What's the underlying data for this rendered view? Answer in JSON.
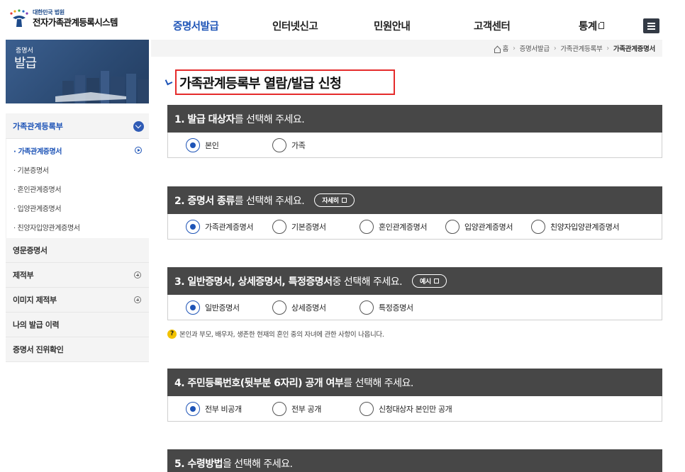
{
  "header": {
    "logo_sub": "대한민국 법원",
    "logo_main": "전자가족관계등록시스템",
    "nav": [
      "증명서발급",
      "인터넷신고",
      "민원안내",
      "고객센터",
      "통계"
    ]
  },
  "sidebar": {
    "banner_line1": "증명서",
    "banner_line2": "발급",
    "group_title": "가족관계등록부",
    "sub_items": [
      "· 가족관계증명서",
      "· 기본증명서",
      "· 혼인관계증명서",
      "· 입양관계증명서",
      "· 친양자입양관계증명서"
    ],
    "rows": [
      "영문증명서",
      "제적부",
      "이미지 제적부",
      "나의 발급 이력",
      "증명서 진위확인"
    ]
  },
  "breadcrumb": {
    "home": "홈",
    "items": [
      "증명서발급",
      "가족관계등록부",
      "가족관계증명서"
    ]
  },
  "page_title": "가족관계등록부 열람/발급 신청",
  "sections": [
    {
      "head_bold": "1. 발급 대상자",
      "head_rest": "를 선택해 주세요.",
      "options": [
        "본인",
        "가족"
      ],
      "selected": 0
    },
    {
      "head_bold": "2. 증명서 종류",
      "head_rest": "를 선택해 주세요.",
      "pill": "자세히",
      "options": [
        "가족관계증명서",
        "기본증명서",
        "혼인관계증명서",
        "입양관계증명서",
        "친양자입양관계증명서"
      ],
      "selected": 0
    },
    {
      "head_bold": "3. 일반증명서, 상세증명서, 특정증명서",
      "head_rest": " 중 선택해 주세요.",
      "pill": "예시",
      "options": [
        "일반증명서",
        "상세증명서",
        "특정증명서"
      ],
      "selected": 0
    },
    {
      "head_bold": "4. 주민등록번호(뒷부분 6자리) 공개 여부",
      "head_rest": "를 선택해 주세요.",
      "options": [
        "전부 비공개",
        "전부 공개",
        "신청대상자 본인만 공개"
      ],
      "selected": 0
    },
    {
      "head_bold": "5. 수령방법",
      "head_rest": "을 선택해 주세요."
    }
  ],
  "note": "본인과 부모, 배우자, 생존한 현재의 혼인 중의 자녀에 관한 사항이 나옵니다.",
  "colors": {
    "accent": "#1e54b7",
    "section_head": "#474747",
    "title_border": "#e52b2b"
  }
}
